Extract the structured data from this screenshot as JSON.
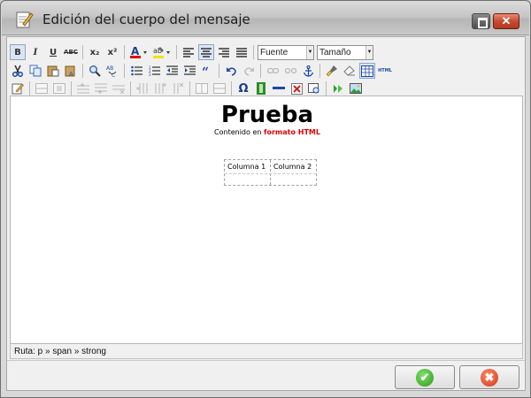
{
  "window": {
    "title": "Edición del cuerpo del mensaje"
  },
  "toolbar": {
    "font_select": "Fuente",
    "size_select": "Tamaño",
    "bold_label": "B",
    "italic_label": "I",
    "underline_label": "U",
    "strike_label": "ABC",
    "subscript_label": "x₂",
    "superscript_label": "x²",
    "omega_label": "Ω",
    "html_label": "HTML"
  },
  "editor": {
    "heading": "Prueba",
    "subline_prefix": "Contenido en ",
    "subline_strong": "formato HTML",
    "table": {
      "columns": [
        "Columna 1",
        "Columna 2"
      ]
    }
  },
  "status": {
    "path": "Ruta: p » span » strong"
  },
  "colors": {
    "accent_red": "#e00000",
    "ok_green": "#2e9a1c",
    "cancel_red": "#d2361a"
  }
}
